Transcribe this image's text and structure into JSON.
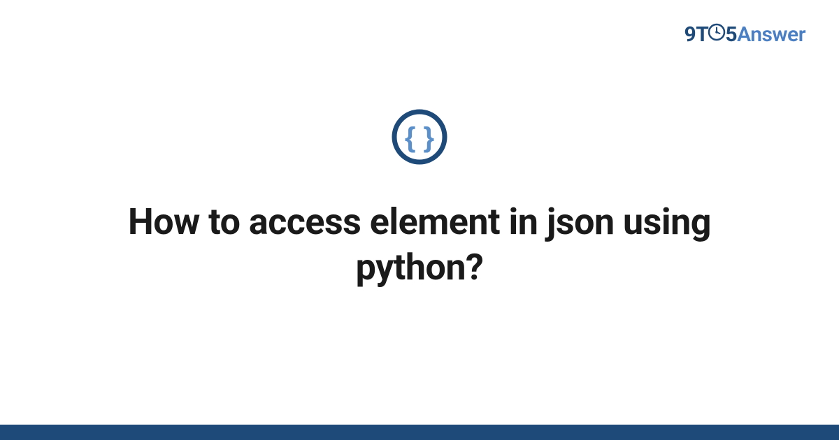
{
  "logo": {
    "part1": "9T",
    "part2": "5",
    "part3": "Answer"
  },
  "main": {
    "title": "How to access element in json using python?"
  },
  "colors": {
    "dark_blue": "#1e4a7a",
    "light_blue": "#4a7fc4",
    "icon_outer": "#1e4a7a",
    "icon_inner": "#5a8fc9"
  }
}
